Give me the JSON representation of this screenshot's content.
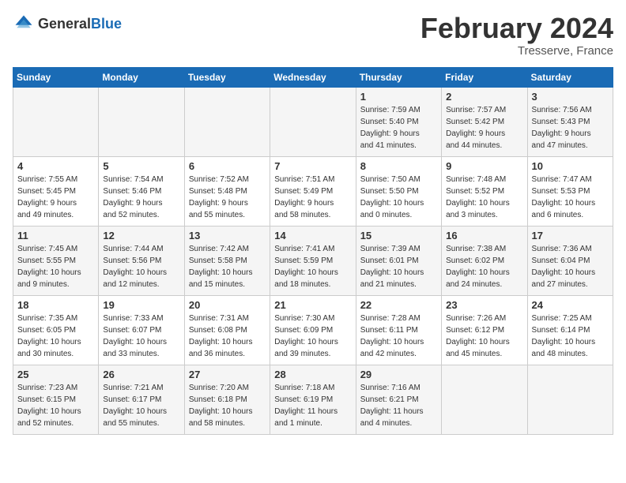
{
  "logo": {
    "general": "General",
    "blue": "Blue"
  },
  "header": {
    "title": "February 2024",
    "subtitle": "Tresserve, France"
  },
  "days_of_week": [
    "Sunday",
    "Monday",
    "Tuesday",
    "Wednesday",
    "Thursday",
    "Friday",
    "Saturday"
  ],
  "weeks": [
    [
      {
        "num": "",
        "info": ""
      },
      {
        "num": "",
        "info": ""
      },
      {
        "num": "",
        "info": ""
      },
      {
        "num": "",
        "info": ""
      },
      {
        "num": "1",
        "info": "Sunrise: 7:59 AM\nSunset: 5:40 PM\nDaylight: 9 hours\nand 41 minutes."
      },
      {
        "num": "2",
        "info": "Sunrise: 7:57 AM\nSunset: 5:42 PM\nDaylight: 9 hours\nand 44 minutes."
      },
      {
        "num": "3",
        "info": "Sunrise: 7:56 AM\nSunset: 5:43 PM\nDaylight: 9 hours\nand 47 minutes."
      }
    ],
    [
      {
        "num": "4",
        "info": "Sunrise: 7:55 AM\nSunset: 5:45 PM\nDaylight: 9 hours\nand 49 minutes."
      },
      {
        "num": "5",
        "info": "Sunrise: 7:54 AM\nSunset: 5:46 PM\nDaylight: 9 hours\nand 52 minutes."
      },
      {
        "num": "6",
        "info": "Sunrise: 7:52 AM\nSunset: 5:48 PM\nDaylight: 9 hours\nand 55 minutes."
      },
      {
        "num": "7",
        "info": "Sunrise: 7:51 AM\nSunset: 5:49 PM\nDaylight: 9 hours\nand 58 minutes."
      },
      {
        "num": "8",
        "info": "Sunrise: 7:50 AM\nSunset: 5:50 PM\nDaylight: 10 hours\nand 0 minutes."
      },
      {
        "num": "9",
        "info": "Sunrise: 7:48 AM\nSunset: 5:52 PM\nDaylight: 10 hours\nand 3 minutes."
      },
      {
        "num": "10",
        "info": "Sunrise: 7:47 AM\nSunset: 5:53 PM\nDaylight: 10 hours\nand 6 minutes."
      }
    ],
    [
      {
        "num": "11",
        "info": "Sunrise: 7:45 AM\nSunset: 5:55 PM\nDaylight: 10 hours\nand 9 minutes."
      },
      {
        "num": "12",
        "info": "Sunrise: 7:44 AM\nSunset: 5:56 PM\nDaylight: 10 hours\nand 12 minutes."
      },
      {
        "num": "13",
        "info": "Sunrise: 7:42 AM\nSunset: 5:58 PM\nDaylight: 10 hours\nand 15 minutes."
      },
      {
        "num": "14",
        "info": "Sunrise: 7:41 AM\nSunset: 5:59 PM\nDaylight: 10 hours\nand 18 minutes."
      },
      {
        "num": "15",
        "info": "Sunrise: 7:39 AM\nSunset: 6:01 PM\nDaylight: 10 hours\nand 21 minutes."
      },
      {
        "num": "16",
        "info": "Sunrise: 7:38 AM\nSunset: 6:02 PM\nDaylight: 10 hours\nand 24 minutes."
      },
      {
        "num": "17",
        "info": "Sunrise: 7:36 AM\nSunset: 6:04 PM\nDaylight: 10 hours\nand 27 minutes."
      }
    ],
    [
      {
        "num": "18",
        "info": "Sunrise: 7:35 AM\nSunset: 6:05 PM\nDaylight: 10 hours\nand 30 minutes."
      },
      {
        "num": "19",
        "info": "Sunrise: 7:33 AM\nSunset: 6:07 PM\nDaylight: 10 hours\nand 33 minutes."
      },
      {
        "num": "20",
        "info": "Sunrise: 7:31 AM\nSunset: 6:08 PM\nDaylight: 10 hours\nand 36 minutes."
      },
      {
        "num": "21",
        "info": "Sunrise: 7:30 AM\nSunset: 6:09 PM\nDaylight: 10 hours\nand 39 minutes."
      },
      {
        "num": "22",
        "info": "Sunrise: 7:28 AM\nSunset: 6:11 PM\nDaylight: 10 hours\nand 42 minutes."
      },
      {
        "num": "23",
        "info": "Sunrise: 7:26 AM\nSunset: 6:12 PM\nDaylight: 10 hours\nand 45 minutes."
      },
      {
        "num": "24",
        "info": "Sunrise: 7:25 AM\nSunset: 6:14 PM\nDaylight: 10 hours\nand 48 minutes."
      }
    ],
    [
      {
        "num": "25",
        "info": "Sunrise: 7:23 AM\nSunset: 6:15 PM\nDaylight: 10 hours\nand 52 minutes."
      },
      {
        "num": "26",
        "info": "Sunrise: 7:21 AM\nSunset: 6:17 PM\nDaylight: 10 hours\nand 55 minutes."
      },
      {
        "num": "27",
        "info": "Sunrise: 7:20 AM\nSunset: 6:18 PM\nDaylight: 10 hours\nand 58 minutes."
      },
      {
        "num": "28",
        "info": "Sunrise: 7:18 AM\nSunset: 6:19 PM\nDaylight: 11 hours\nand 1 minute."
      },
      {
        "num": "29",
        "info": "Sunrise: 7:16 AM\nSunset: 6:21 PM\nDaylight: 11 hours\nand 4 minutes."
      },
      {
        "num": "",
        "info": ""
      },
      {
        "num": "",
        "info": ""
      }
    ]
  ]
}
